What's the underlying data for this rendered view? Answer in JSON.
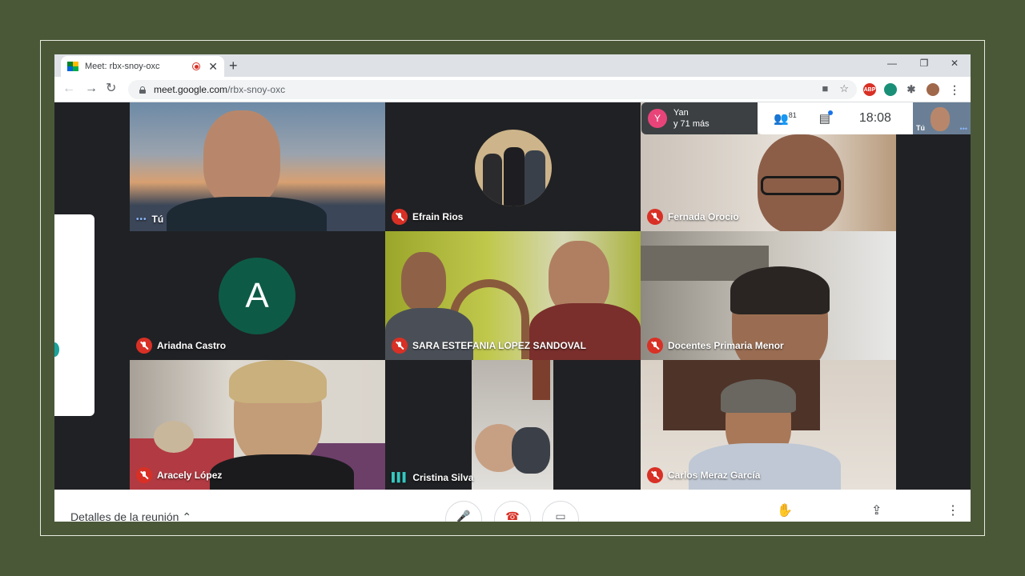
{
  "browser": {
    "tab_title": "Meet: rbx-snoy-oxc",
    "tab_close": "✕",
    "new_tab": "+",
    "window_controls": {
      "minimize": "—",
      "restore": "❐",
      "close": "✕"
    },
    "nav": {
      "back": "←",
      "forward": "→",
      "reload": "↻"
    },
    "url_host": "meet.google.com",
    "url_path": "/rbx-snoy-oxc",
    "omnibox_icons": {
      "camera": "■",
      "star": "☆"
    },
    "extensions": {
      "abp": "ABP",
      "menu": "⋮",
      "puzzle": "✱"
    }
  },
  "meet": {
    "presenter": {
      "initial": "Y",
      "name": "Yan",
      "more": "y 71 más"
    },
    "participant_count": "81",
    "clock": "18:08",
    "self_tile_label": "Tú",
    "self_tile_menu": "•••",
    "tiles": [
      {
        "name": "Tú",
        "status": "dots"
      },
      {
        "name": "Efrain Rios",
        "status": "muted"
      },
      {
        "name": "Fernada Orocio",
        "status": "muted"
      },
      {
        "name": "Ariadna Castro",
        "status": "muted",
        "avatar_letter": "A"
      },
      {
        "name": "SARA ESTEFANIA LOPEZ SANDOVAL",
        "status": "muted"
      },
      {
        "name": "Docentes Primaria Menor",
        "status": "muted"
      },
      {
        "name": "Aracely López",
        "status": "muted"
      },
      {
        "name": "Cristina Silva",
        "status": "speaking"
      },
      {
        "name": "Carlos Meraz García",
        "status": "muted"
      }
    ],
    "tile_dots": "•••",
    "speaking_glyph": "▌▌▌",
    "bottom": {
      "details": "Detalles de la reunión",
      "details_chevron": "⌃",
      "mic": "🎤",
      "hangup": "☎",
      "camera": "▭",
      "raise_hand": "✋",
      "present": "⇪",
      "more": "⋮"
    }
  },
  "colors": {
    "page_bg": "#4a5838",
    "meet_bg": "#202124",
    "muted_red": "#d93025",
    "avatar_A": "#0d5b47",
    "presenter_avatar": "#e8447a"
  }
}
